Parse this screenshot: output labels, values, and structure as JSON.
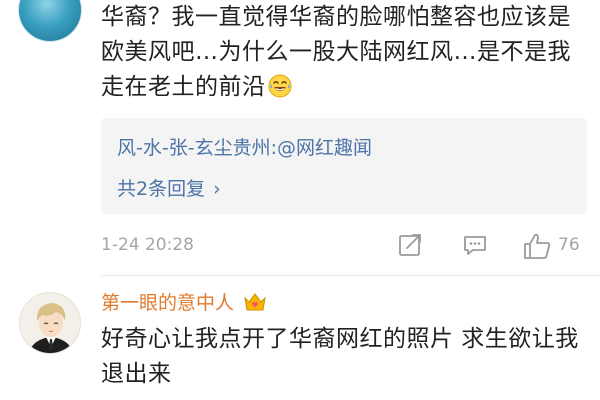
{
  "comment1": {
    "text": "华裔？我一直觉得华裔的脸哪怕整容也应该是欧美风吧…为什么一股大陆网红风…是不是我走在老土的前沿",
    "emoji": "laugh-crying-emoji"
  },
  "reply_box": {
    "user": "风-水-张-玄尘贵州",
    "separator": ":",
    "mention": "@网红趣闻",
    "count_label": "共2条回复",
    "chevron": "›"
  },
  "meta": {
    "timestamp": "1-24 20:28",
    "like_count": "76"
  },
  "comment2": {
    "username": "第一眼的意中人",
    "badge": "crown-heart-badge",
    "text": "好奇心让我点开了华裔网红的照片 求生欲让我退出来"
  },
  "colors": {
    "link": "#4d74a6",
    "username": "#e07b2e",
    "meta": "#a5a5a5",
    "reply_bg": "#f4f4f4"
  }
}
